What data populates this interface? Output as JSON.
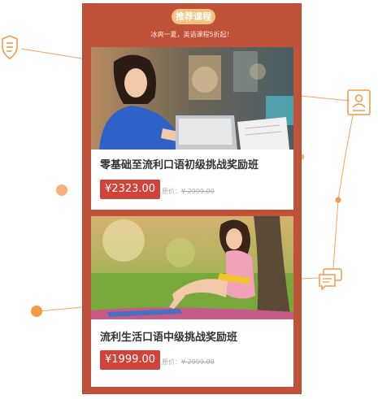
{
  "header": {
    "badge": "推荐课程",
    "subtitle": "冰爽一夏，英语课程5折起！"
  },
  "courses": [
    {
      "title": "零基础至流利口语初级挑战奖励班",
      "price": "¥2323.00",
      "original_label": "原价：",
      "original_price": "¥ 2999.00"
    },
    {
      "title": "流利生活口语中级挑战奖励班",
      "price": "¥1999.00",
      "original_label": "原价：",
      "original_price": "¥ 2999.00"
    }
  ],
  "colors": {
    "accent": "#c1523a",
    "badge": "#f4c27c",
    "price": "#d0433a",
    "decoration": "#f29a4a"
  },
  "icons": [
    "shield-list-icon",
    "id-card-icon",
    "chat-bubbles-icon"
  ]
}
